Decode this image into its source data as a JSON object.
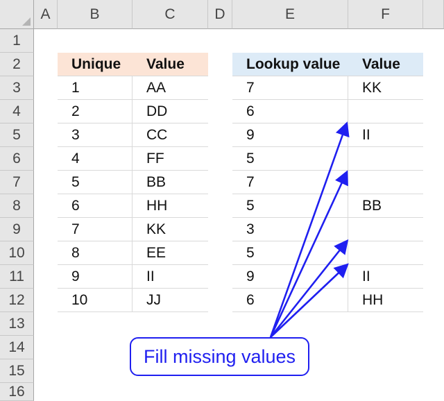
{
  "columns": [
    "A",
    "B",
    "C",
    "D",
    "E",
    "F"
  ],
  "rows": [
    "1",
    "2",
    "3",
    "4",
    "5",
    "6",
    "7",
    "8",
    "9",
    "10",
    "11",
    "12",
    "13",
    "14",
    "15",
    "16"
  ],
  "table_left": {
    "headers": [
      "Unique",
      "Value"
    ],
    "rows": [
      [
        "1",
        "AA"
      ],
      [
        "2",
        "DD"
      ],
      [
        "3",
        "CC"
      ],
      [
        "4",
        "FF"
      ],
      [
        "5",
        "BB"
      ],
      [
        "6",
        "HH"
      ],
      [
        "7",
        "KK"
      ],
      [
        "8",
        "EE"
      ],
      [
        "9",
        "II"
      ],
      [
        "10",
        "JJ"
      ]
    ]
  },
  "table_right": {
    "headers": [
      "Lookup value",
      "Value"
    ],
    "rows": [
      [
        "7",
        "KK"
      ],
      [
        "6",
        ""
      ],
      [
        "9",
        "II"
      ],
      [
        "5",
        ""
      ],
      [
        "7",
        ""
      ],
      [
        "5",
        "BB"
      ],
      [
        "3",
        ""
      ],
      [
        "5",
        ""
      ],
      [
        "9",
        "II"
      ],
      [
        "6",
        "HH"
      ]
    ]
  },
  "annotation": {
    "text": "Fill missing values",
    "color": "#1f1ff0"
  },
  "colors": {
    "left_header_fill": "#fce4d6",
    "right_header_fill": "#ddebf7",
    "header_bar": "#e6e6e6"
  }
}
